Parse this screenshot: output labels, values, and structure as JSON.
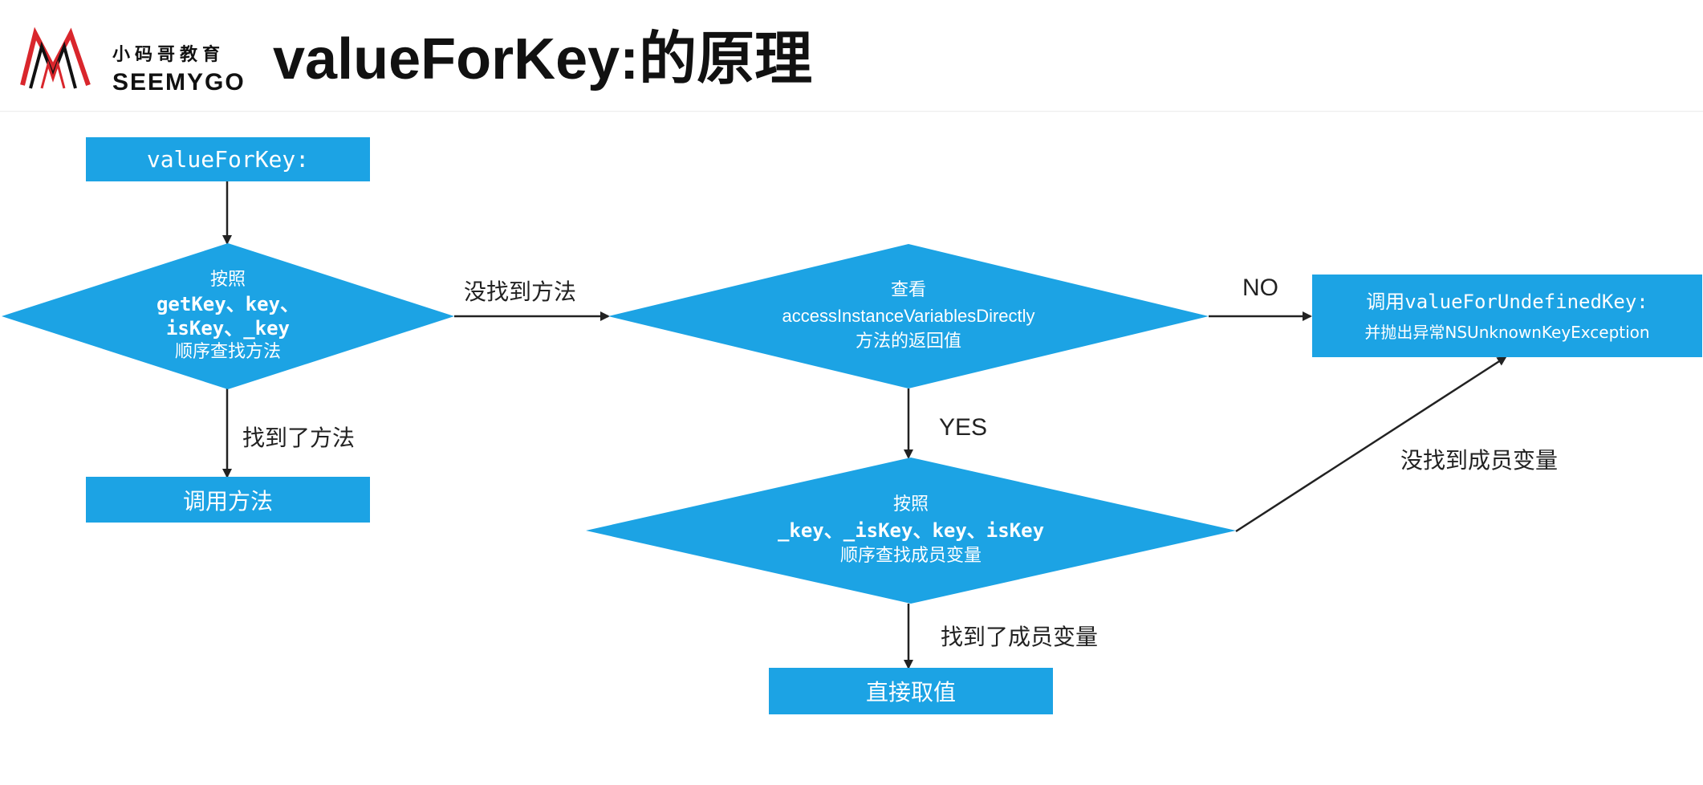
{
  "header": {
    "logo_cn": "小码哥教育",
    "logo_en": "SEEMYGO",
    "title": "valueForKey:的原理"
  },
  "nodes": {
    "start": "valueForKey:",
    "lookup_methods": {
      "line1": "按照",
      "line2": "getKey、key、",
      "line3": "isKey、_key",
      "line4": "顺序查找方法"
    },
    "call_method": "调用方法",
    "check_access": {
      "line1": "查看",
      "line2": "accessInstanceVariablesDirectly",
      "line3": "方法的返回值"
    },
    "undefined_key": {
      "line1_prefix": "调用",
      "line1_code": "valueForUndefinedKey:",
      "line2": "并抛出异常NSUnknownKeyException"
    },
    "lookup_ivars": {
      "line1": "按照",
      "line2": "_key、_isKey、key、isKey",
      "line3": "顺序查找成员变量"
    },
    "get_value": "直接取值"
  },
  "edges": {
    "method_not_found": "没找到方法",
    "method_found": "找到了方法",
    "no": "NO",
    "yes": "YES",
    "ivar_not_found": "没找到成员变量",
    "ivar_found": "找到了成员变量"
  },
  "colors": {
    "node_fill": "#1ca3e4",
    "arrow": "#222222",
    "logo_red": "#d9262c"
  }
}
